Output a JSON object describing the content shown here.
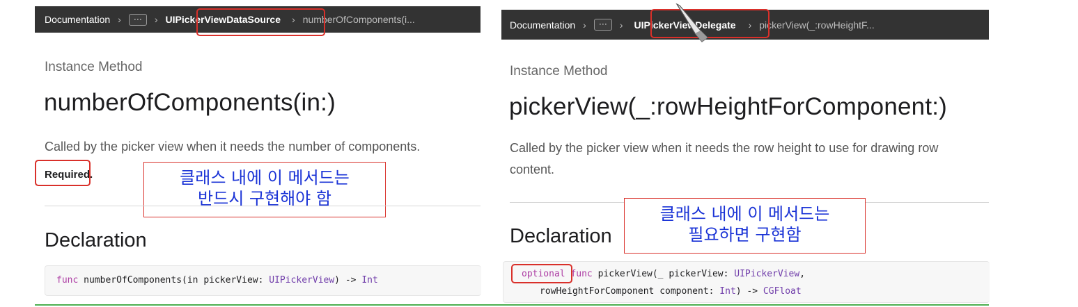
{
  "left": {
    "breadcrumb": {
      "root": "Documentation",
      "sep": "›",
      "dots": "···",
      "current": "UIPickerViewDataSource",
      "last": "numberOfComponents(i..."
    },
    "kicker": "Instance Method",
    "title": "numberOfComponents(in:)",
    "abstract": "Called by the picker view when it needs the number of components.",
    "required": "Required.",
    "declaration_heading": "Declaration",
    "code": {
      "kw_func": "func",
      "fn": " numberOfComponents(in pickerView: ",
      "type1": "UIPickerView",
      "arrow": ") -> ",
      "ret": "Int"
    },
    "note_line1": "클래스 내에 이 메서드는",
    "note_line2": "반드시 구현해야 함"
  },
  "right": {
    "breadcrumb": {
      "root": "Documentation",
      "sep": "›",
      "dots": "···",
      "current": "UIPickerViewDelegate",
      "last": "pickerView(_:rowHeightF..."
    },
    "kicker": "Instance Method",
    "title": "pickerView(_:rowHeightForComponent:)",
    "abstract_line1": "Called by the picker view when it needs the row height to use for drawing row",
    "abstract_line2": "content.",
    "declaration_heading": "Declaration",
    "code": {
      "optional": "optional",
      "kw_func": " func",
      "l1_rest": " pickerView(_ pickerView: ",
      "type1": "UIPickerView",
      "comma": ",",
      "l2_a": "rowHeightForComponent",
      "l2_b": " component: ",
      "type2": "Int",
      "arrow": ") -> ",
      "ret": "CGFloat"
    },
    "note_line1": "클래스 내에 이 메서드는",
    "note_line2": "필요하면 구현함"
  },
  "colors": {
    "annotation_red": "#d9302a",
    "annotation_blue_text": "#1a33d6",
    "breadcrumb_bg": "#333333",
    "keyword": "#ad3da4",
    "type": "#703daa"
  }
}
